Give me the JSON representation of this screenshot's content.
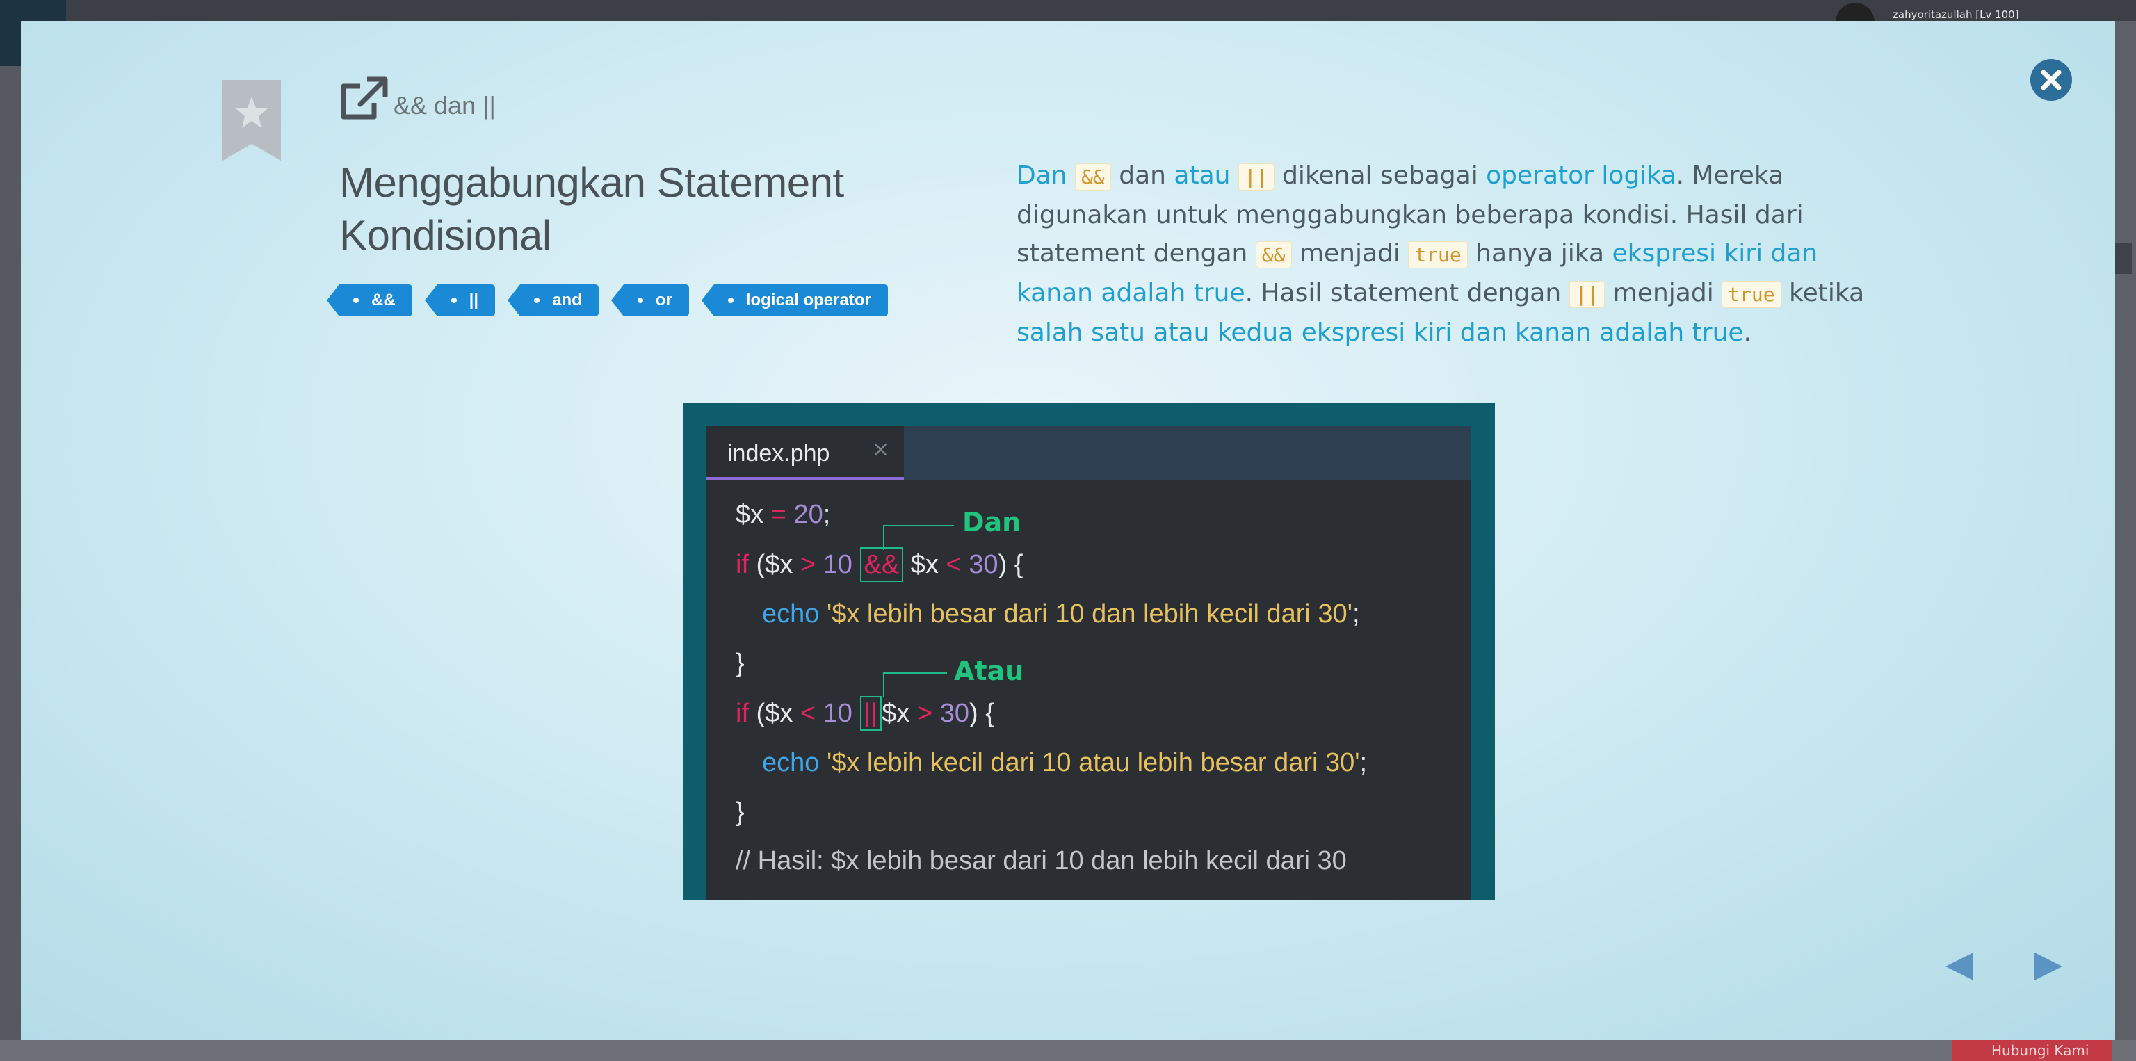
{
  "backdrop": {
    "username": "zahyoritazullah [Lv 100]",
    "footer_button_label": "Hubungi Kami"
  },
  "modal": {
    "subtitle": "&& dan ||",
    "title": "Menggabungkan Statement Kondisional",
    "tags": [
      "&&",
      "||",
      "and",
      "or",
      "logical operator"
    ],
    "description": {
      "p1_a": "Dan",
      "p1_code1": "&&",
      "p1_b": " dan ",
      "p1_c": "atau",
      "p1_code2": "||",
      "p1_d": " dikenal sebagai ",
      "p1_e": "operator logika",
      "p1_f": ". Mereka digunakan untuk menggabungkan beberapa kondisi. Hasil dari statement dengan ",
      "p1_code3": "&&",
      "p1_g": " menjadi ",
      "p1_code4": "true",
      "p1_h": " hanya jika ",
      "p1_i": "ekspresi kiri dan kanan adalah true",
      "p1_j": ". Hasil statement dengan ",
      "p1_code5": "||",
      "p1_k": " menjadi ",
      "p1_code6": "true",
      "p1_l": " ketika ",
      "p1_m": "salah satu atau kedua ekspresi kiri dan kanan adalah true",
      "p1_n": "."
    },
    "code_image": {
      "tab_name": "index.php",
      "tab_close": "×",
      "annotation_and": "Dan",
      "annotation_or": "Atau",
      "lines": [
        "$x = 20;",
        "if ($x > 10 && $x < 30) {",
        "echo '$x lebih besar dari 10 dan lebih kecil dari 30';",
        "}",
        "if ($x < 10 || $x > 30) {",
        "echo '$x lebih kecil dari 10 atau lebih besar dari 30';",
        "}",
        "// Hasil: $x lebih besar dari 10 dan lebih kecil dari 30"
      ]
    }
  },
  "colors": {
    "accent": "#1b8ad6",
    "link": "#1e9fd0",
    "close_button": "#2d6d99",
    "code_frame": "#0d5d6c"
  },
  "icons": {
    "bookmark": "bookmark-star-icon",
    "open": "external-link-icon",
    "close": "close-circle-icon",
    "prev": "triangle-left-icon",
    "next": "triangle-right-icon"
  }
}
